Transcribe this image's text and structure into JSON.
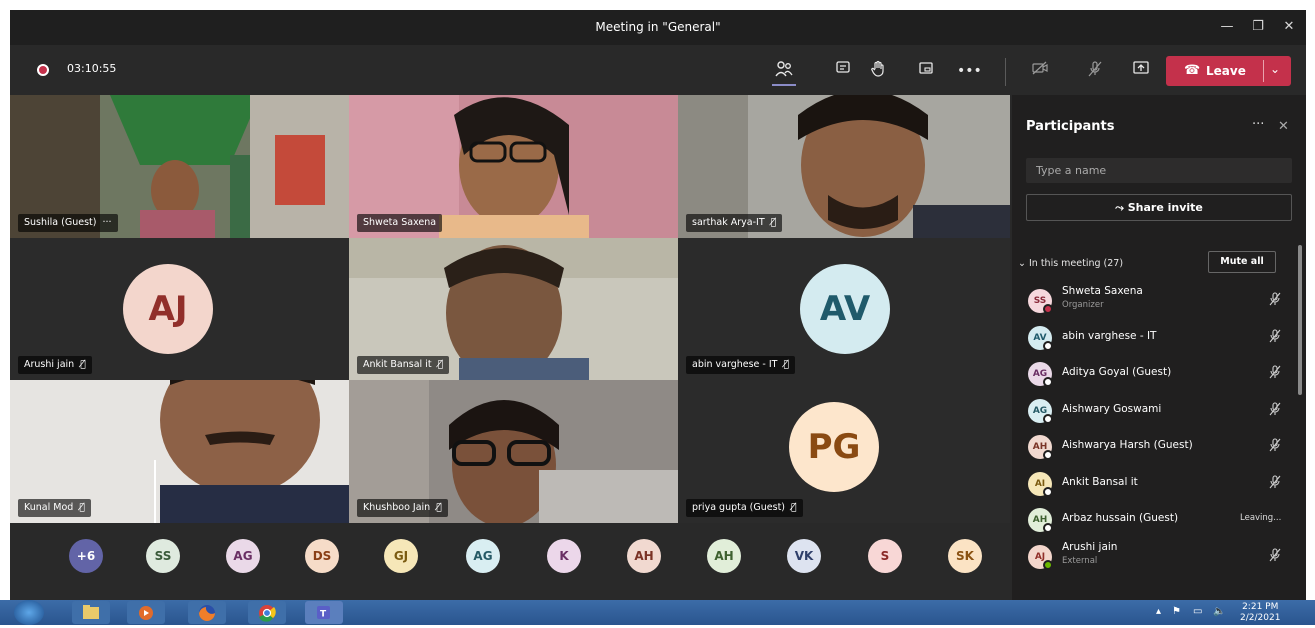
{
  "window": {
    "title": "Meeting in \"General\"",
    "minimize": "—",
    "maximize": "❐",
    "close": "✕"
  },
  "toolbar": {
    "timer": "03:10:55",
    "leave_label": "Leave",
    "icons": [
      "participants-icon",
      "chat-icon",
      "raise-hand-icon",
      "rooms-icon",
      "more-icon",
      "camera-off-icon",
      "mic-off-icon",
      "share-screen-icon"
    ]
  },
  "tiles": [
    {
      "name": "Sushila (Guest)",
      "suffix": "···",
      "type": "video",
      "bg": "#6f7b65"
    },
    {
      "name": "Shweta Saxena",
      "suffix": "",
      "type": "video",
      "bg": "#b37a86"
    },
    {
      "name": "sarthak Arya-IT",
      "suffix": "🎙̸",
      "type": "video",
      "bg": "#a9a9a5"
    },
    {
      "name": "Arushi jain",
      "suffix": "🎙̸",
      "type": "avatar",
      "initials": "AJ",
      "color": "#f3d6cc",
      "text": "#912f2a"
    },
    {
      "name": "Ankit Bansal it",
      "suffix": "🎙̸",
      "type": "video",
      "bg": "#9e9d94"
    },
    {
      "name": "abin varghese - IT",
      "suffix": "🎙̸",
      "type": "avatar",
      "initials": "AV",
      "color": "#d4ebf0",
      "text": "#1f5a6b"
    },
    {
      "name": "Kunal Mod",
      "suffix": "🎙̸",
      "type": "video",
      "bg": "#cfc8c2"
    },
    {
      "name": "Khushboo Jain",
      "suffix": "🎙̸",
      "type": "video",
      "bg": "#8e8782"
    },
    {
      "name": "priya gupta (Guest)",
      "suffix": "🎙̸",
      "type": "avatar",
      "initials": "PG",
      "color": "#fde6cc",
      "text": "#8a4a12"
    }
  ],
  "tray": [
    {
      "initials": "+6",
      "color": "#6264a7",
      "text": "#ffffff"
    },
    {
      "initials": "SS",
      "color": "#dfeadf",
      "text": "#3a5a3a"
    },
    {
      "initials": "AG",
      "color": "#ead9e8",
      "text": "#6a2f64"
    },
    {
      "initials": "DS",
      "color": "#f6dcc8",
      "text": "#8a3f16"
    },
    {
      "initials": "GJ",
      "color": "#f6e7b8",
      "text": "#7a5a10"
    },
    {
      "initials": "AG",
      "color": "#d9eef2",
      "text": "#265a66"
    },
    {
      "initials": "K",
      "color": "#ecd7ea",
      "text": "#6a2f64"
    },
    {
      "initials": "AH",
      "color": "#f1d9d0",
      "text": "#7a3326"
    },
    {
      "initials": "AH",
      "color": "#e1eed9",
      "text": "#3e6130"
    },
    {
      "initials": "VK",
      "color": "#dde3f0",
      "text": "#2f3f6a"
    },
    {
      "initials": "S",
      "color": "#f8d7d6",
      "text": "#8a2a28"
    },
    {
      "initials": "SK",
      "color": "#fbe3c4",
      "text": "#8a5212"
    }
  ],
  "panel": {
    "title": "Participants",
    "more": "···",
    "close": "✕",
    "search_placeholder": "Type a name",
    "share_invite": "Share invite",
    "section": "In this meeting (27)",
    "mute_all": "Mute all",
    "participants": [
      {
        "initials": "SS",
        "name": "Shweta Saxena",
        "sub": "Organizer",
        "status": "busy",
        "right": "mic-off",
        "color": "#f6d8dd",
        "text": "#8a2a3a"
      },
      {
        "initials": "AV",
        "name": "abin varghese - IT",
        "sub": "",
        "status": "away",
        "right": "mic-off",
        "color": "#d4ebf0",
        "text": "#1f5a6b"
      },
      {
        "initials": "AG",
        "name": "Aditya Goyal (Guest)",
        "sub": "",
        "status": "away",
        "right": "mic-off",
        "color": "#ead9e8",
        "text": "#6a2f64"
      },
      {
        "initials": "AG",
        "name": "Aishwary Goswami",
        "sub": "",
        "status": "away",
        "right": "mic-off",
        "color": "#d9eef2",
        "text": "#265a66"
      },
      {
        "initials": "AH",
        "name": "Aishwarya Harsh (Guest)",
        "sub": "",
        "status": "away",
        "right": "mic-off",
        "color": "#f1d9d0",
        "text": "#7a3326"
      },
      {
        "initials": "AI",
        "name": "Ankit Bansal it",
        "sub": "",
        "status": "away",
        "right": "mic-off",
        "color": "#f6e7b8",
        "text": "#7a5a10"
      },
      {
        "initials": "AH",
        "name": "Arbaz hussain (Guest)",
        "sub": "",
        "status": "away",
        "right": "Leaving...",
        "color": "#e1eed9",
        "text": "#3e6130"
      },
      {
        "initials": "AJ",
        "name": "Arushi jain",
        "sub": "External",
        "status": "available",
        "right": "mic-off",
        "color": "#f3d6cc",
        "text": "#912f2a"
      }
    ]
  },
  "taskbar": {
    "time": "2:21 PM",
    "date": "2/2/2021"
  },
  "colors": {
    "leave": "#c4314b",
    "teams_purple": "#6264a7",
    "busy": "#c4314b",
    "available": "#6bb700"
  }
}
